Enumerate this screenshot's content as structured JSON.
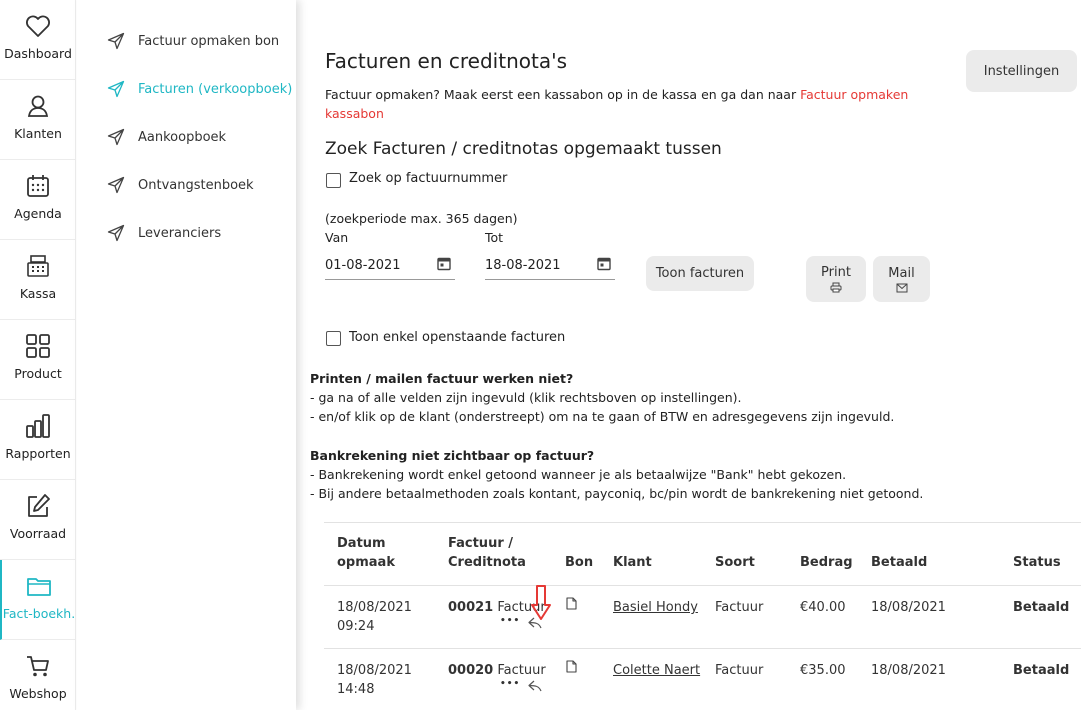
{
  "rail": [
    {
      "label": "Dashboard",
      "icon": "heart-icon"
    },
    {
      "label": "Klanten",
      "icon": "user-icon"
    },
    {
      "label": "Agenda",
      "icon": "calendar-icon"
    },
    {
      "label": "Kassa",
      "icon": "cash-register-icon"
    },
    {
      "label": "Product",
      "icon": "grid-icon"
    },
    {
      "label": "Rapporten",
      "icon": "bar-chart-icon"
    },
    {
      "label": "Voorraad",
      "icon": "edit-icon"
    },
    {
      "label": "Fact-boekh.",
      "icon": "folder-icon",
      "active": true
    },
    {
      "label": "Webshop",
      "icon": "cart-icon"
    }
  ],
  "submenu": [
    {
      "label": "Factuur opmaken bon"
    },
    {
      "label": "Facturen (verkoopboek)",
      "active": true
    },
    {
      "label": "Aankoopboek"
    },
    {
      "label": "Ontvangstenboek"
    },
    {
      "label": "Leveranciers"
    }
  ],
  "page": {
    "title": "Facturen en creditnota's",
    "settings_button": "Instellingen",
    "intro_text": "Factuur opmaken? Maak eerst een kassabon op in de kassa en ga dan naar ",
    "intro_link_line1": "Factuur opmaken",
    "intro_link_line2": "kassabon",
    "search_title": "Zoek Facturen / creditnotas opgemaakt tussen",
    "search_by_number_label": "Zoek op factuurnummer",
    "period_note": "(zoekperiode max. 365 dagen)",
    "from_label": "Van",
    "to_label": "Tot",
    "from_date": "01-08-2021",
    "to_date": "18-08-2021",
    "show_button": "Toon facturen",
    "print_button": "Print",
    "mail_button": "Mail",
    "open_only_label": "Toon enkel openstaande facturen",
    "note1_title": "Printen / mailen factuur werken niet?",
    "note1_line1": "- ga na of alle velden zijn ingevuld (klik rechtsboven op instellingen).",
    "note1_line2": "- en/of klik op de klant (onderstreept) om na te gaan of BTW en adresgegevens zijn ingevuld.",
    "note2_title": "Bankrekening niet zichtbaar op factuur?",
    "note2_line1": "- Bankrekening wordt enkel getoond wanneer je als betaalwijze \"Bank\" hebt gekozen.",
    "note2_line2": "- Bij andere betaalmethoden zoals kontant, payconiq, bc/pin wordt de bankrekening niet getoond."
  },
  "table": {
    "headers": {
      "date_line1": "Datum",
      "date_line2": "opmaak",
      "invoice_line1": "Factuur /",
      "invoice_line2": "Creditnota",
      "bon": "Bon",
      "client": "Klant",
      "type": "Soort",
      "amount": "Bedrag",
      "paid": "Betaald",
      "status": "Status"
    },
    "rows": [
      {
        "date": "18/08/2021",
        "time": "09:24",
        "number": "00021",
        "kind_label": "Factuur",
        "more": "•••",
        "client": "Basiel Hondy",
        "type": "Factuur",
        "amount": "€40.00",
        "paid": "18/08/2021",
        "status": "Betaald"
      },
      {
        "date": "18/08/2021",
        "time": "14:48",
        "number": "00020",
        "kind_label": "Factuur",
        "more": "•••",
        "client": "Colette Naert",
        "type": "Factuur",
        "amount": "€35.00",
        "paid": "18/08/2021",
        "status": "Betaald"
      }
    ]
  },
  "colors": {
    "accent": "#1fb7c4",
    "link_red": "#e53935",
    "annotation_arrow": "#e53935"
  }
}
